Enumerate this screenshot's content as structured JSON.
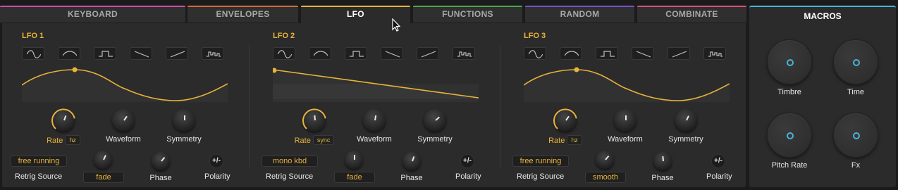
{
  "tabs": [
    {
      "label": "KEYBOARD",
      "color": "#c94fa8",
      "active": false
    },
    {
      "label": "ENVELOPES",
      "color": "#d36b3c",
      "active": false
    },
    {
      "label": "LFO",
      "color": "#e8b33a",
      "active": true
    },
    {
      "label": "FUNCTIONS",
      "color": "#4aa84a",
      "active": false
    },
    {
      "label": "RANDOM",
      "color": "#7a52c9",
      "active": false
    },
    {
      "label": "COMBINATE",
      "color": "#d94f7a",
      "active": false
    }
  ],
  "accent": "#e8b33a",
  "macros": {
    "title": "MACROS",
    "color": "#4ab2d8",
    "items": [
      {
        "label": "Timbre"
      },
      {
        "label": "Time"
      },
      {
        "label": "Pitch Rate"
      },
      {
        "label": "Fx"
      }
    ]
  },
  "lfos": [
    {
      "title": "LFO 1",
      "shapes": [
        "sine-icon",
        "soft-sine-icon",
        "square-icon",
        "ramp-down-icon",
        "ramp-up-icon",
        "random-steps-icon"
      ],
      "rate_label": "Rate",
      "rate_unit": "hz",
      "waveform_label": "Waveform",
      "symmetry_label": "Symmetry",
      "retrig_value": "free running",
      "retrig_label": "Retrig Source",
      "mode_value": "fade",
      "phase_label": "Phase",
      "polarity_symbol": "+/-",
      "polarity_label": "Polarity",
      "wave": "sine"
    },
    {
      "title": "LFO 2",
      "shapes": [
        "sine-icon",
        "soft-sine-icon",
        "square-icon",
        "ramp-down-icon",
        "ramp-up-icon",
        "random-steps-icon"
      ],
      "rate_label": "Rate",
      "rate_unit": "sync",
      "waveform_label": "Waveform",
      "symmetry_label": "Symmetry",
      "retrig_value": "mono kbd",
      "retrig_label": "Retrig Source",
      "mode_value": "fade",
      "phase_label": "Phase",
      "polarity_symbol": "+/-",
      "polarity_label": "Polarity",
      "wave": "ramp"
    },
    {
      "title": "LFO 3",
      "shapes": [
        "sine-icon",
        "soft-sine-icon",
        "square-icon",
        "ramp-down-icon",
        "ramp-up-icon",
        "random-steps-icon"
      ],
      "rate_label": "Rate",
      "rate_unit": "hz",
      "waveform_label": "Waveform",
      "symmetry_label": "Symmetry",
      "retrig_value": "free running",
      "retrig_label": "Retrig Source",
      "mode_value": "smooth",
      "phase_label": "Phase",
      "polarity_symbol": "+/-",
      "polarity_label": "Polarity",
      "wave": "sine"
    }
  ]
}
